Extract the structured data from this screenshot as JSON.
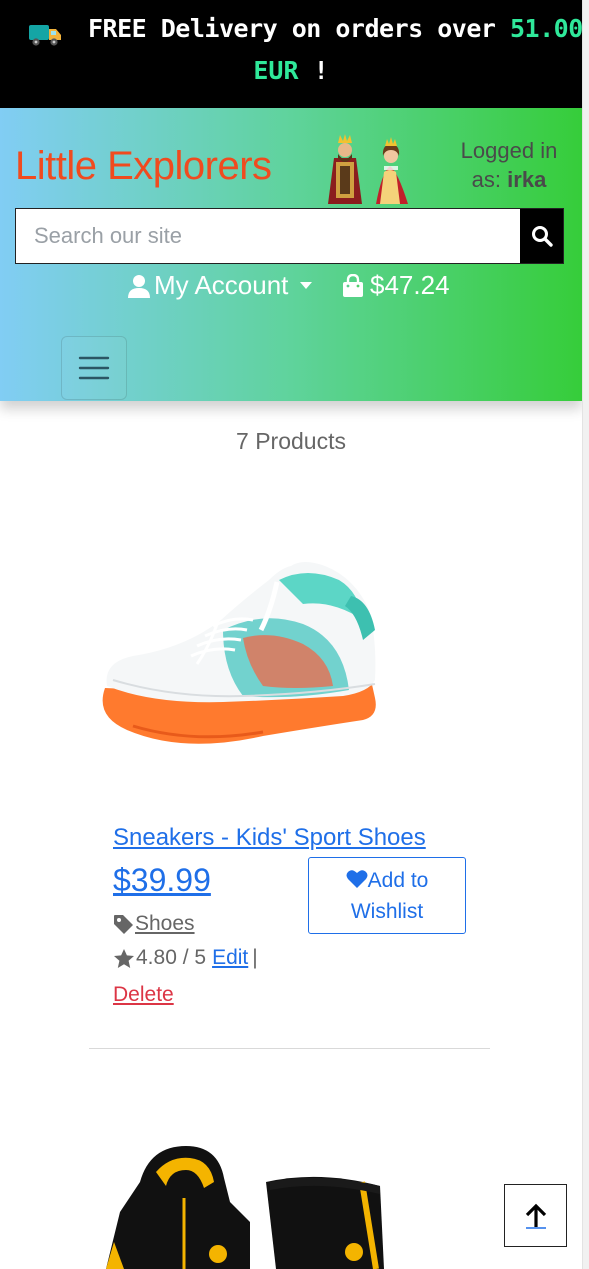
{
  "promo": {
    "lead": "FREE Delivery on orders over ",
    "amount": "51.00",
    "currency": "EUR",
    "tail": " !"
  },
  "header": {
    "brand": "Little Explorers",
    "logged_in_label": "Logged in as:",
    "username": "irka",
    "search_placeholder": "Search our site",
    "account_label": "My Account",
    "cart_total": "$47.24"
  },
  "listing": {
    "count_text": "7 Products",
    "products": [
      {
        "name": "Sneakers - Kids' Sport Shoes",
        "price": "$39.99",
        "category": "Shoes",
        "rating": "4.80 / 5",
        "edit_label": "Edit",
        "separator": "|",
        "delete_label": "Delete",
        "wishlist_label": "Add to Wishlist"
      }
    ]
  },
  "colors": {
    "brand": "#f04b1f",
    "promo_accent": "#2fe89a",
    "link": "#1f6fe8",
    "danger": "#dc3545",
    "header_gradient": [
      "#81cdf4",
      "#36cd3a"
    ]
  },
  "icons": [
    "truck-icon",
    "royal-couple-icon",
    "search-icon",
    "user-icon",
    "shopping-bag-icon",
    "hamburger-menu-icon",
    "heart-icon",
    "tag-icon",
    "star-icon",
    "arrow-up-icon"
  ]
}
